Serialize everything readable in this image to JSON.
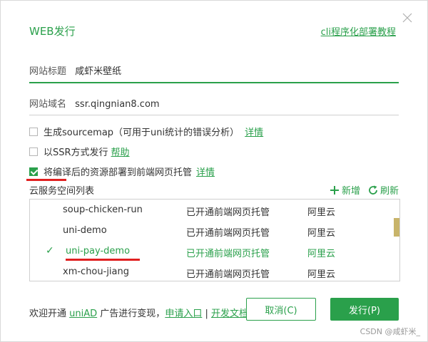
{
  "dialog": {
    "title": "WEB发行",
    "cli_link": "cli程序化部署教程"
  },
  "fields": {
    "site_title_label": "网站标题",
    "site_title_value": "咸虾米壁纸",
    "domain_label": "网站域名",
    "domain_value": "ssr.qingnian8.com"
  },
  "options": {
    "sourcemap_label": "生成sourcemap（可用于uni统计的错误分析）",
    "sourcemap_link": "详情",
    "sourcemap_checked": false,
    "ssr_label": "以SSR方式发行",
    "ssr_link": "帮助",
    "ssr_checked": false,
    "deploy_label": "将编译后的资源部署到前端网页托管",
    "deploy_link": "详情",
    "deploy_checked": true
  },
  "cloud_list": {
    "title": "云服务空间列表",
    "add_label": "新增",
    "refresh_label": "刷新",
    "rows": [
      {
        "name": "soup-chicken-run",
        "status": "已开通前端网页托管",
        "vendor": "阿里云",
        "selected": false
      },
      {
        "name": "uni-demo",
        "status": "已开通前端网页托管",
        "vendor": "阿里云",
        "selected": false
      },
      {
        "name": "uni-pay-demo",
        "status": "已开通前端网页托管",
        "vendor": "阿里云",
        "selected": true
      },
      {
        "name": "xm-chou-jiang",
        "status": "已开通前端网页托管",
        "vendor": "阿里云",
        "selected": false
      }
    ],
    "check_glyph": "✓"
  },
  "footer": {
    "text_prefix": "欢迎开通",
    "uniad_link": "uniAD",
    "text_middle": "广告进行变现，",
    "apply_link": "申请入口",
    "separator": "|",
    "docs_link": "开发文档",
    "cancel_label": "取消(C)",
    "publish_label": "发行(P)"
  },
  "watermark": "CSDN @咸虾米_",
  "colors": {
    "accent": "#2aa04b",
    "highlight_underline": "#e02020"
  }
}
